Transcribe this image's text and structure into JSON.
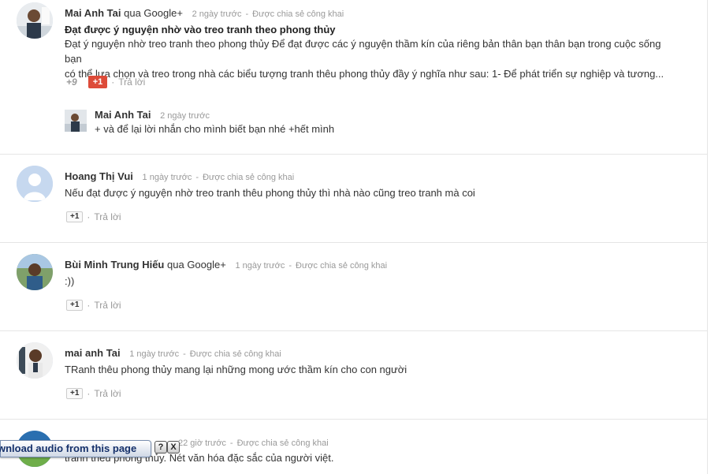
{
  "comments": [
    {
      "author": "Mai Anh Tai",
      "via": "qua Google+",
      "time": "2 ngày trước",
      "visibility": "Được chia sẻ công khai",
      "title": "Đạt được ý nguyện nhờ vào treo tranh theo phong thủy",
      "text_line1": "Đạt ý nguyện nhờ treo tranh theo phong thủy Để đạt được các ý nguyện thầm kín của riêng bản thân bạn thân bạn trong cuộc sống bạn",
      "text_line2": "có thể lựa chọn và treo trong nhà các biểu tượng tranh thêu phong thủy đầy ý nghĩa như sau: 1- Để phát triển sự nghiệp và tương...",
      "plus_count": "+9",
      "plus_label": "+1",
      "reply_label": "Trả lời",
      "reply": {
        "author": "Mai Anh Tai",
        "time": "2 ngày trước",
        "text": "+ và để lại lời nhắn cho mình biết bạn nhé +hết mình"
      }
    },
    {
      "author": "Hoang Thị Vui",
      "time": "1 ngày trước",
      "visibility": "Được chia sẻ công khai",
      "text": "Nếu đạt được ý nguyện nhờ treo tranh thêu phong thủy thì nhà nào cũng treo tranh mà coi",
      "plus_label": "+1",
      "reply_label": "Trả lời"
    },
    {
      "author": "Bùi Minh Trung Hiếu",
      "via": "qua Google+",
      "time": "1 ngày trước",
      "visibility": "Được chia sẻ công khai",
      "text": ":))",
      "plus_label": "+1",
      "reply_label": "Trả lời"
    },
    {
      "author": "mai anh Tai",
      "time": "1 ngày trước",
      "visibility": "Được chia sẻ công khai",
      "text": "TRanh thêu phong thủy mang lại những mong ước thầm kín cho con người",
      "plus_label": "+1",
      "reply_label": "Trả lời"
    },
    {
      "time": "22 giờ trước",
      "visibility": "Được chia sẻ công khai",
      "text": "tranh thêu phong thủy. Nét văn hóa đặc sắc của người việt."
    }
  ],
  "download_bar": {
    "label": "wnload audio from this page",
    "help": "?",
    "close": "X"
  },
  "colors": {
    "plus_red": "#dd4b39",
    "meta_gray": "#999999",
    "divider": "#e5e5e5"
  }
}
